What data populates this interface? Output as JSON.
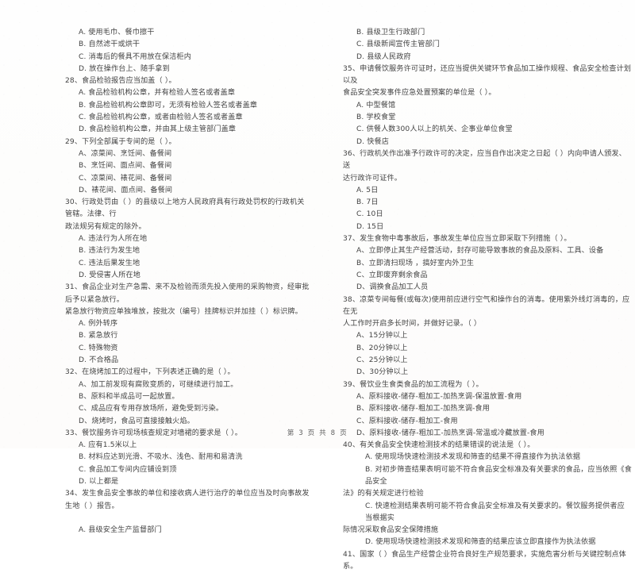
{
  "document": {
    "type": "scanned-exam-paper",
    "footer": "第 3 页 共 8 页"
  },
  "left_column": {
    "blocks": [
      {
        "kind": "option",
        "text": "A. 使用毛巾、餐巾擦干"
      },
      {
        "kind": "option",
        "text": "B. 自然滤干或烘干"
      },
      {
        "kind": "option",
        "text": "C. 消毒后的餐具不用放在保洁柜内"
      },
      {
        "kind": "option",
        "text": "D. 放在操作台上、随手拿到"
      },
      {
        "kind": "question",
        "text": "28、食品检验报告应当加盖（        ）。"
      },
      {
        "kind": "option",
        "text": "A. 食品检验机构公章，并有检验人签名或者盖章"
      },
      {
        "kind": "option",
        "text": "B. 食品检验机构公章即可，无须有检验人签名或者盖章"
      },
      {
        "kind": "option",
        "text": "C. 食品检验机构公章，或者由检验人签名或者盖章"
      },
      {
        "kind": "option",
        "text": "D. 食品检验机构公章，并由其上级主管部门盖章"
      },
      {
        "kind": "question",
        "text": "29、下列全部属于专间的是（        ）。"
      },
      {
        "kind": "option",
        "text": "A、凉菜间、烹饪间、备餐间"
      },
      {
        "kind": "option",
        "text": "B、烹饪间、面点间、备餐间"
      },
      {
        "kind": "option",
        "text": "C、凉菜间、裱花间、备餐间"
      },
      {
        "kind": "option",
        "text": "D、裱花间、面点间、备餐间"
      },
      {
        "kind": "question",
        "text": "30、行政处罚由（     ）的县级以上地方人民政府具有行政处罚权的行政机关管辖。法律、行"
      },
      {
        "kind": "question-cont",
        "text": "政法规另有规定的除外。"
      },
      {
        "kind": "option",
        "text": "A. 违法行为人所在地"
      },
      {
        "kind": "option",
        "text": "B. 违法行为发生地"
      },
      {
        "kind": "option",
        "text": "C. 违法后果发生地"
      },
      {
        "kind": "option",
        "text": "D. 受侵害人所在地"
      },
      {
        "kind": "question",
        "text": "31、食品企业对生产急需、来不及检验而须先投入使用的采购物资，经审批后予以紧急放行。"
      },
      {
        "kind": "question-cont",
        "text": "紧急放行物资应单独堆放，按批次（编号）挂牌标识并加挂（     ）标识牌。"
      },
      {
        "kind": "option",
        "text": "A. 例外转序"
      },
      {
        "kind": "option",
        "text": "B. 紧急放行"
      },
      {
        "kind": "option",
        "text": "C. 特殊物资"
      },
      {
        "kind": "option",
        "text": "D. 不合格品"
      },
      {
        "kind": "question",
        "text": "32、在烧烤加工的过程中，下列表述正确的是（     ）。"
      },
      {
        "kind": "option",
        "text": "A、加工前发现有腐败变质的，可继续进行加工。"
      },
      {
        "kind": "option",
        "text": "B、原料和半成品可一起放置。"
      },
      {
        "kind": "option",
        "text": "C、成品应有专用存放场所，避免受到污染。"
      },
      {
        "kind": "option",
        "text": "D、烧烤时，食品可直接接触火焰。"
      },
      {
        "kind": "question",
        "text": "33、餐饮服务许可现场核查规定对墙裙的要求是（     ）。"
      },
      {
        "kind": "option",
        "text": "A. 应有1.5米以上"
      },
      {
        "kind": "option",
        "text": "B. 材料应达到光滑、不吸水、浅色、耐用和易清洗"
      },
      {
        "kind": "option",
        "text": "C. 食品加工专间内应铺设到顶"
      },
      {
        "kind": "option",
        "text": "D. 以上都是"
      },
      {
        "kind": "question",
        "text": "34、发生食品安全事故的单位和接收病人进行治疗的单位应当及时向事故发生地（     ）报告。"
      },
      {
        "kind": "blank",
        "text": ""
      },
      {
        "kind": "option",
        "text": "A. 县级安全生产监督部门"
      }
    ]
  },
  "right_column": {
    "blocks": [
      {
        "kind": "option",
        "text": "B. 县级卫生行政部门"
      },
      {
        "kind": "option",
        "text": "C. 县级新闻宣传主管部门"
      },
      {
        "kind": "option",
        "text": "D. 县级人民政府"
      },
      {
        "kind": "question",
        "text": "35、申请餐饮服务许可证时，还应当提供关键环节食品加工操作规程、食品安全检查计划以及"
      },
      {
        "kind": "question-cont",
        "text": "食品安全突发事件应急处置预案的单位是（     ）。"
      },
      {
        "kind": "option",
        "text": "A. 中型餐馆"
      },
      {
        "kind": "option",
        "text": "B. 学校食堂"
      },
      {
        "kind": "option",
        "text": "C. 供餐人数300人以上的机关、企事业单位食堂"
      },
      {
        "kind": "option",
        "text": "D. 快餐店"
      },
      {
        "kind": "question",
        "text": "36、行政机关作出准予行政许可的决定，应当自作出决定之日起（     ）内向申请人颁发、送"
      },
      {
        "kind": "question-cont",
        "text": "达行政许可证件。"
      },
      {
        "kind": "option",
        "text": "A. 5日"
      },
      {
        "kind": "option",
        "text": "B. 7日"
      },
      {
        "kind": "option",
        "text": "C. 10日"
      },
      {
        "kind": "option",
        "text": "D. 15日"
      },
      {
        "kind": "question",
        "text": "37、发生食物中毒事故后，事故发生单位应当立即采取下列措施（     ）。"
      },
      {
        "kind": "option",
        "text": "A、立即停止其生产经营活动，封存可能导致事故的食品及原料、工具、设备"
      },
      {
        "kind": "option",
        "text": "B、立即清扫现场 ，搞好室内外卫生"
      },
      {
        "kind": "option",
        "text": "C、立即废弃剩余食品"
      },
      {
        "kind": "option",
        "text": "D、调换食品加工人员"
      },
      {
        "kind": "question",
        "text": "38、凉菜专间每餐(或每次)使用前应进行空气和操作台的消毒。使用紫外线灯消毒的，应在无"
      },
      {
        "kind": "question-cont",
        "text": "人工作时开启多长时间，并做好记录。（     ）"
      },
      {
        "kind": "option",
        "text": "A、15分钟以上"
      },
      {
        "kind": "option",
        "text": "B、20分钟以上"
      },
      {
        "kind": "option",
        "text": "C、25分钟以上"
      },
      {
        "kind": "option",
        "text": "D、30分钟以上"
      },
      {
        "kind": "question",
        "text": "39、餐饮业生食类食品的加工流程为（     ）。"
      },
      {
        "kind": "option",
        "text": "A、原料接收-储存-粗加工-加热烹调-保温放置-食用"
      },
      {
        "kind": "option",
        "text": "B、原料接收-储存-粗加工-加热烹调-食用"
      },
      {
        "kind": "option",
        "text": "C、原料接收-储存-粗加工-食用"
      },
      {
        "kind": "option",
        "text": "D、原料接收-储存-粗加工-加热烹调-常温或冷藏放置-食用"
      },
      {
        "kind": "question",
        "text": "40、有关食品安全快速检测技术的结果错误的说法是（     ）。"
      },
      {
        "kind": "option-deep",
        "text": "A. 使用现场快速检测技术发现和筛查的结果不得直接作为执法依据"
      },
      {
        "kind": "option-deep",
        "text": "B. 对初步筛查结果表明可能不符合食品安全标准及有关要求的食品，应当依照《食品安全"
      },
      {
        "kind": "option-flush",
        "text": "法》的有关规定进行检验"
      },
      {
        "kind": "option-deep",
        "text": "C. 快速检测结果表明可能不符合食品安全标准及有关要求的。餐饮服务提供者应当根据实"
      },
      {
        "kind": "option-flush",
        "text": "际情况采取食品安全保障措施"
      },
      {
        "kind": "option-deep",
        "text": "D. 使用现场快速检测技术发现和筛查的结果应该立即直接作为执法依据"
      },
      {
        "kind": "question",
        "text": "41、国家（     ）食品生产经营企业符合良好生产规范要求，实施危害分析与关键控制点体系。"
      }
    ]
  }
}
